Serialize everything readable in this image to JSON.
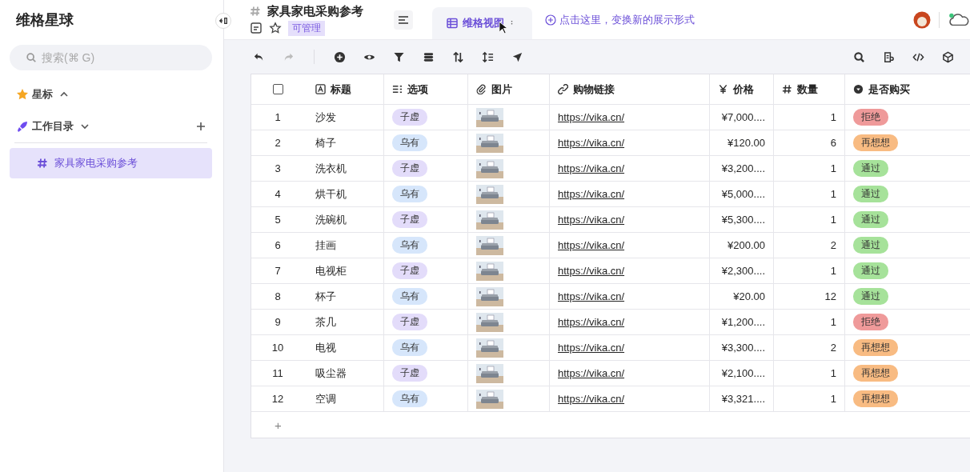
{
  "sidebar": {
    "title": "维格星球",
    "search": {
      "placeholder": "搜索(⌘ G)"
    },
    "sections": [
      {
        "label": "星标",
        "expanded": true
      },
      {
        "label": "工作目录",
        "expanded": false
      }
    ],
    "items": [
      {
        "label": "家具家电采购参考",
        "selected": true
      }
    ]
  },
  "header": {
    "title": "家具家电采购参考",
    "permission": "可管理",
    "tabs": [
      {
        "label": "维格视图",
        "selected": true
      }
    ],
    "add_view": "点击这里，变换新的展示形式"
  },
  "table": {
    "select_all": {
      "checked": false
    },
    "columns": [
      {
        "label": "标题",
        "kind": "text"
      },
      {
        "label": "选项",
        "kind": "options"
      },
      {
        "label": "图片",
        "kind": "attachment"
      },
      {
        "label": "购物链接",
        "kind": "link"
      },
      {
        "label": "价格",
        "kind": "currency"
      },
      {
        "label": "数量",
        "kind": "number"
      },
      {
        "label": "是否购买",
        "kind": "select"
      }
    ],
    "rows": [
      {
        "index": "1",
        "title": "沙发",
        "option": {
          "label": "子虚",
          "color": "#e3dcfa"
        },
        "link": "https://vika.cn/",
        "price": "¥7,000....",
        "qty": "1",
        "status": {
          "label": "拒绝",
          "color": "#ef9a9a"
        }
      },
      {
        "index": "2",
        "title": "椅子",
        "option": {
          "label": "乌有",
          "color": "#d6e6fb"
        },
        "link": "https://vika.cn/",
        "price": "¥120.00",
        "qty": "6",
        "status": {
          "label": "再想想",
          "color": "#f8bb82"
        }
      },
      {
        "index": "3",
        "title": "洗衣机",
        "option": {
          "label": "子虚",
          "color": "#e3dcfa"
        },
        "link": "https://vika.cn/",
        "price": "¥3,200....",
        "qty": "1",
        "status": {
          "label": "通过",
          "color": "#a6e29a"
        }
      },
      {
        "index": "4",
        "title": "烘干机",
        "option": {
          "label": "乌有",
          "color": "#d6e6fb"
        },
        "link": "https://vika.cn/",
        "price": "¥5,000....",
        "qty": "1",
        "status": {
          "label": "通过",
          "color": "#a6e29a"
        }
      },
      {
        "index": "5",
        "title": "洗碗机",
        "option": {
          "label": "子虚",
          "color": "#e3dcfa"
        },
        "link": "https://vika.cn/",
        "price": "¥5,300....",
        "qty": "1",
        "status": {
          "label": "通过",
          "color": "#a6e29a"
        }
      },
      {
        "index": "6",
        "title": "挂画",
        "option": {
          "label": "乌有",
          "color": "#d6e6fb"
        },
        "link": "https://vika.cn/",
        "price": "¥200.00",
        "qty": "2",
        "status": {
          "label": "通过",
          "color": "#a6e29a"
        }
      },
      {
        "index": "7",
        "title": "电视柜",
        "option": {
          "label": "子虚",
          "color": "#e3dcfa"
        },
        "link": "https://vika.cn/",
        "price": "¥2,300....",
        "qty": "1",
        "status": {
          "label": "通过",
          "color": "#a6e29a"
        }
      },
      {
        "index": "8",
        "title": "杯子",
        "option": {
          "label": "乌有",
          "color": "#d6e6fb"
        },
        "link": "https://vika.cn/",
        "price": "¥20.00",
        "qty": "12",
        "status": {
          "label": "通过",
          "color": "#a6e29a"
        }
      },
      {
        "index": "9",
        "title": "茶几",
        "option": {
          "label": "子虚",
          "color": "#e3dcfa"
        },
        "link": "https://vika.cn/",
        "price": "¥1,200....",
        "qty": "1",
        "status": {
          "label": "拒绝",
          "color": "#ef9a9a"
        }
      },
      {
        "index": "10",
        "title": "电视",
        "option": {
          "label": "乌有",
          "color": "#d6e6fb"
        },
        "link": "https://vika.cn/",
        "price": "¥3,300....",
        "qty": "2",
        "status": {
          "label": "再想想",
          "color": "#f8bb82"
        }
      },
      {
        "index": "11",
        "title": "吸尘器",
        "option": {
          "label": "子虚",
          "color": "#e3dcfa"
        },
        "link": "https://vika.cn/",
        "price": "¥2,100....",
        "qty": "1",
        "status": {
          "label": "再想想",
          "color": "#f8bb82"
        }
      },
      {
        "index": "12",
        "title": "空调",
        "option": {
          "label": "乌有",
          "color": "#d6e6fb"
        },
        "link": "https://vika.cn/",
        "price": "¥3,321....",
        "qty": "1",
        "status": {
          "label": "再想想",
          "color": "#f8bb82"
        }
      }
    ],
    "add_row": "+"
  }
}
